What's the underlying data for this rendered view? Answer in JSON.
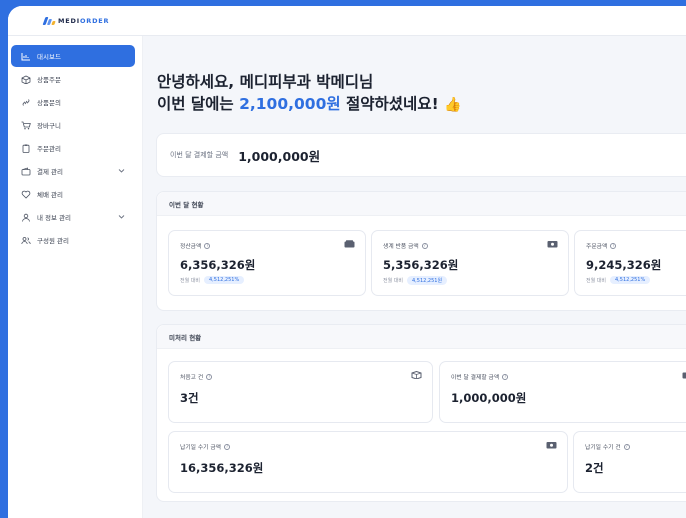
{
  "app": {
    "logo_prefix": "MEDI",
    "logo_suffix": "ORDER"
  },
  "sidebar": {
    "items": [
      {
        "label": "대시보드",
        "icon": "chart-icon"
      },
      {
        "label": "상품주문",
        "icon": "box-icon"
      },
      {
        "label": "상품문의",
        "icon": "link-icon"
      },
      {
        "label": "장바구니",
        "icon": "cart-icon"
      },
      {
        "label": "주문관리",
        "icon": "clipboard-icon"
      },
      {
        "label": "결제 관리",
        "icon": "wallet-icon"
      },
      {
        "label": "체배 관리",
        "icon": "heart-icon"
      },
      {
        "label": "내 정보 관리",
        "icon": "user-icon"
      },
      {
        "label": "구성원 관리",
        "icon": "users-icon"
      }
    ]
  },
  "greeting": {
    "line1": "안녕하세요, 메디피부과 박메디님",
    "line2_prefix": "이번 달에는 ",
    "amount": "2,100,000원",
    "line2_suffix": " 절약하셨네요! ",
    "emoji": "👍"
  },
  "payment": {
    "label": "이번 달 결제할 금액",
    "value": "1,000,000원"
  },
  "monthly": {
    "title": "이번 달 현황",
    "cards": [
      {
        "label": "정산금액",
        "value": "6,356,326원",
        "sub": "전월 대비",
        "badge": "4,512,251%"
      },
      {
        "label": "생계 반품 금액",
        "value": "5,356,326원",
        "sub": "전월 대비",
        "badge": "4,512,251원"
      },
      {
        "label": "주문금액",
        "value": "9,245,326원",
        "sub": "전월 대비",
        "badge": "4,512,251%"
      }
    ]
  },
  "pending": {
    "title": "미처리 현황",
    "cards": [
      {
        "label": "처음고 건",
        "value": "3건"
      },
      {
        "label": "이번 달 결제할 금액",
        "value": "1,000,000원"
      },
      {
        "label": "납기일 수기 금액",
        "value": "16,356,326원"
      },
      {
        "label": "납기일 수기 건",
        "value": "2건"
      }
    ]
  }
}
